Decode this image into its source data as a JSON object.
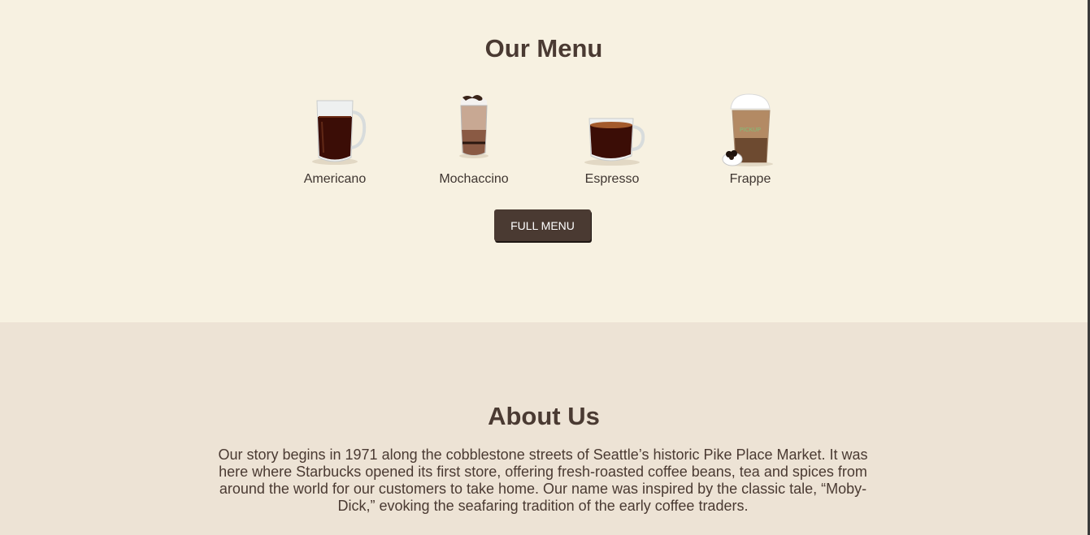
{
  "menu": {
    "title": "Our Menu",
    "items": [
      {
        "label": "Americano",
        "icon": "americano-mug-icon"
      },
      {
        "label": "Mochaccino",
        "icon": "mochaccino-glass-icon"
      },
      {
        "label": "Espresso",
        "icon": "espresso-cup-icon"
      },
      {
        "label": "Frappe",
        "icon": "frappe-cup-icon"
      }
    ],
    "button_label": "FULL MENU"
  },
  "about": {
    "title": "About Us",
    "text": "Our story begins in 1971 along the cobblestone streets of Seattle’s historic Pike Place Market. It was here where Starbucks opened its first store, offering fresh-roasted coffee beans, tea and spices from around the world for our customers to take home. Our name was inspired by the classic tale, “Moby-Dick,” evoking the seafaring tradition of the early coffee traders."
  },
  "colors": {
    "menu_bg": "#f7f1e1",
    "about_bg": "#ede3d5",
    "text_dark": "#4a3a32",
    "button_bg": "#4a3a32"
  }
}
